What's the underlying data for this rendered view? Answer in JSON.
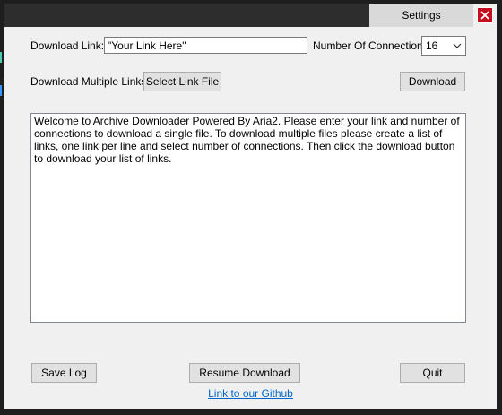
{
  "window": {
    "tab_label": "Settings",
    "close_icon": "close-icon"
  },
  "form": {
    "download_link_label": "Download Link:",
    "download_link_value": "\"Your Link Here\"",
    "connections_label": "Number Of Connections:",
    "connections_value": "16",
    "multiple_links_label": "Download Multiple Links",
    "select_link_file_button": "Select Link File",
    "download_button": "Download"
  },
  "log": {
    "text": "Welcome to Archive Downloader Powered By Aria2. Please enter your link and number of connections to download a single file. To download multiple files please create a list of links, one link per line and select number of connections. Then click the download button to download your list of links."
  },
  "footer": {
    "save_log_button": "Save Log",
    "resume_download_button": "Resume Download",
    "quit_button": "Quit",
    "github_link": "Link to our Github"
  },
  "colors": {
    "close_button": "#c50f1f",
    "link": "#0066cc",
    "window_bg": "#f0f0f0"
  }
}
